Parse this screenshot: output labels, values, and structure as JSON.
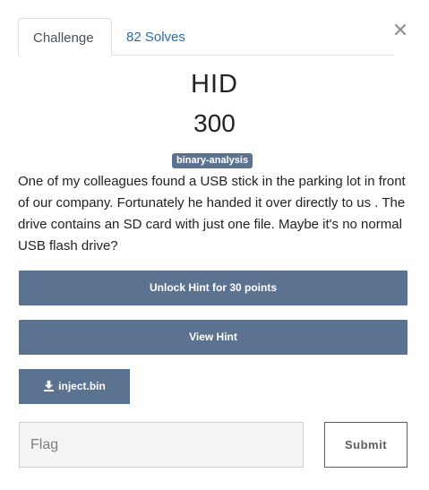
{
  "tabs": [
    {
      "label": "Challenge",
      "active": true
    },
    {
      "label": "82 Solves",
      "active": false
    }
  ],
  "close_icon": "close-icon",
  "challenge": {
    "name": "HID",
    "value": "300",
    "tag": "binary-analysis",
    "description": "One of my colleagues found a USB stick in the parking lot in front of our company. Fortunately he handed it over directly to us . The drive contains an SD card with just one file. Maybe it's no normal USB flash drive?"
  },
  "hints": {
    "unlock_label": "Unlock Hint for 30 points",
    "view_label": "View Hint"
  },
  "file": {
    "icon": "download-icon",
    "name": "inject.bin"
  },
  "submission": {
    "placeholder": "Flag",
    "submit_label": "Submit"
  },
  "colors": {
    "button": "#5b7290",
    "link": "#2b6ca3"
  }
}
